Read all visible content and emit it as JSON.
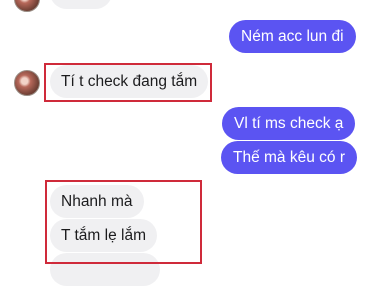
{
  "conversation": {
    "messages": [
      {
        "from": "me",
        "text": "Ném acc lun đi"
      },
      {
        "from": "them",
        "text": "Tí t check đang tắm"
      },
      {
        "from": "me",
        "text": "Vl tí ms check ạ"
      },
      {
        "from": "me",
        "text": "Thế mà kêu có r"
      },
      {
        "from": "them",
        "text": "Nhanh mà"
      },
      {
        "from": "them",
        "text": "T tắm lẹ lắm"
      }
    ]
  },
  "colors": {
    "outgoing_bubble": "#5b54f2",
    "incoming_bubble": "#f0f0f2",
    "highlight_box": "#cf2a3a"
  }
}
